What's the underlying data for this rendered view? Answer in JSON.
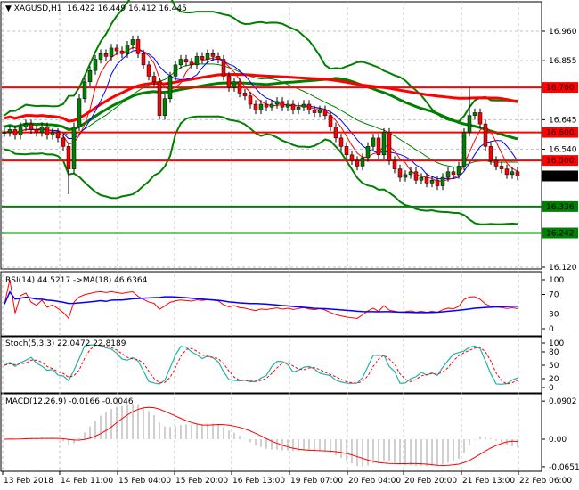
{
  "header": {
    "symbol": "XAGUSD,H1",
    "ohlc": "16.422 16.449 16.412 16.445"
  },
  "price_axis": {
    "min": 16.12,
    "max": 17.05,
    "ticks": [
      "16.960",
      "16.855",
      "16.645",
      "16.540",
      "16.120"
    ]
  },
  "levels": [
    {
      "value": 16.76,
      "label": "16.760",
      "color": "#ff0000"
    },
    {
      "value": 16.6,
      "label": "16.600",
      "color": "#ff0000"
    },
    {
      "value": 16.5,
      "label": "16.500",
      "color": "#ff0000"
    },
    {
      "value": 16.336,
      "label": "16.336",
      "color": "#008000"
    },
    {
      "value": 16.242,
      "label": "16.242",
      "color": "#008000"
    }
  ],
  "current_price": {
    "value": 16.445,
    "label": "16.445"
  },
  "closes": [
    16.6,
    16.61,
    16.59,
    16.62,
    16.63,
    16.61,
    16.6,
    16.62,
    16.59,
    16.6,
    16.58,
    16.55,
    16.47,
    16.62,
    16.72,
    16.78,
    16.82,
    16.86,
    16.88,
    16.87,
    16.9,
    16.89,
    16.88,
    16.91,
    16.93,
    16.88,
    16.84,
    16.8,
    16.78,
    16.66,
    16.72,
    16.8,
    16.84,
    16.86,
    16.85,
    16.84,
    16.87,
    16.86,
    16.88,
    16.87,
    16.86,
    16.8,
    16.76,
    16.78,
    16.74,
    16.73,
    16.7,
    16.68,
    16.7,
    16.69,
    16.7,
    16.71,
    16.69,
    16.7,
    16.68,
    16.69,
    16.7,
    16.68,
    16.67,
    16.68,
    16.66,
    16.62,
    16.58,
    16.55,
    16.52,
    16.5,
    16.48,
    16.51,
    16.55,
    16.58,
    16.52,
    16.6,
    16.5,
    16.47,
    16.44,
    16.45,
    16.46,
    16.43,
    16.44,
    16.42,
    16.43,
    16.41,
    16.44,
    16.46,
    16.45,
    16.48,
    16.6,
    16.66,
    16.67,
    16.63,
    16.55,
    16.5,
    16.48,
    16.47,
    16.45,
    16.46,
    16.445
  ],
  "rsi": {
    "label": "RSI(14) 44.5217  ->MA(18) 46.6364",
    "ticks": [
      "100",
      "70",
      "30",
      "0"
    ]
  },
  "stoch": {
    "label": "Stoch(5,3,3) 22.0472 22.8189",
    "ticks": [
      "100",
      "80",
      "50",
      "20",
      "0"
    ]
  },
  "macd": {
    "label": "MACD(12,26,9) -0.0166 -0.0046",
    "ticks": [
      "0.0902",
      "0.00",
      "-0.0651"
    ]
  },
  "time_axis": [
    "13 Feb 2018",
    "14 Feb 11:00",
    "15 Feb 04:00",
    "15 Feb 20:00",
    "16 Feb 13:00",
    "19 Feb 07:00",
    "20 Feb 04:00",
    "20 Feb 20:00",
    "21 Feb 13:00",
    "22 Feb 06:00"
  ],
  "colors": {
    "bull": "#008000",
    "bear": "#ff0000",
    "grid": "#c0c0c0"
  }
}
